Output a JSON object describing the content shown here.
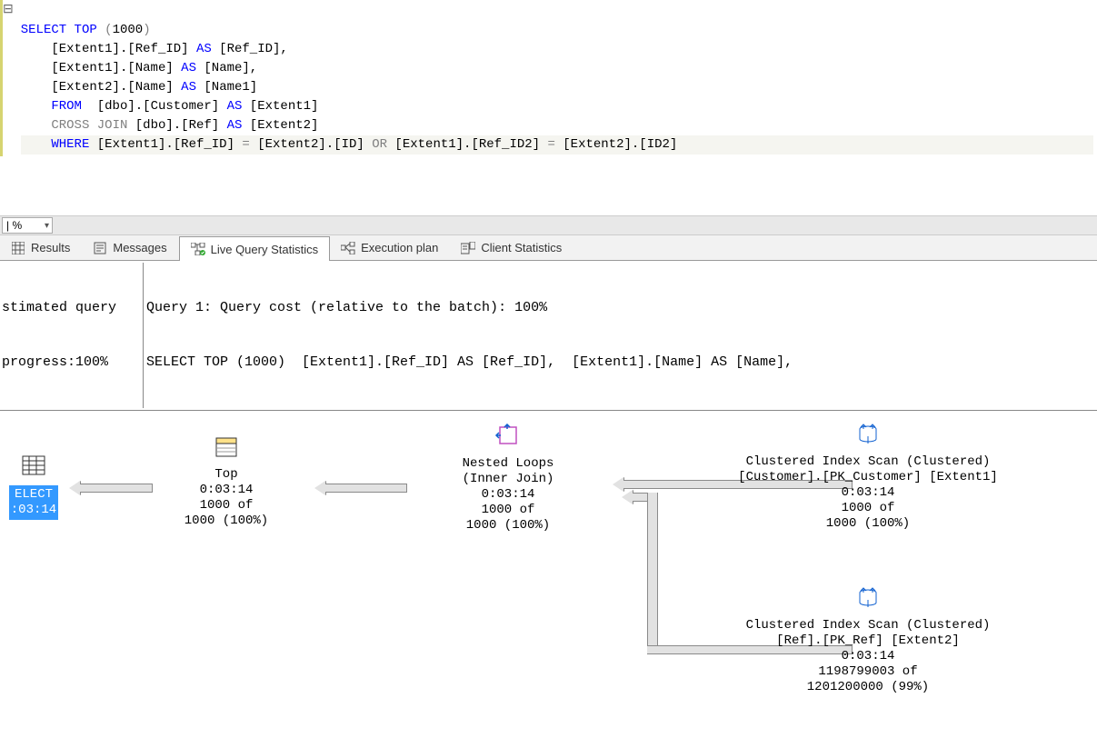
{
  "code": {
    "collapse_symbol": "⊟",
    "line1_a": "SELECT",
    "line1_b": " TOP ",
    "line1_c": "(",
    "line1_d": "1000",
    "line1_e": ")",
    "line2": "    [Extent1].[Ref_ID] ",
    "line2_as": "AS",
    "line2_b": " [Ref_ID],",
    "line3": "    [Extent1].[Name] ",
    "line3_as": "AS",
    "line3_b": " [Name],",
    "line4": "    [Extent2].[Name] ",
    "line4_as": "AS",
    "line4_b": " [Name1]",
    "line5_from": "    FROM",
    "line5_b": "  [dbo].[Customer] ",
    "line5_as": "AS",
    "line5_c": " [Extent1]",
    "line6_cross": "    CROSS",
    "line6_join": " JOIN",
    "line6_b": " [dbo].[Ref] ",
    "line6_as": "AS",
    "line6_c": " [Extent2]",
    "line7_where": "    WHERE",
    "line7_a": " [Extent1].[Ref_ID] ",
    "line7_eq1": "=",
    "line7_b": " [Extent2].[ID] ",
    "line7_or": "OR",
    "line7_c": " [Extent1].[Ref_ID2] ",
    "line7_eq2": "=",
    "line7_d": " [Extent2].[ID2]"
  },
  "zoom": {
    "value": "| % "
  },
  "tabs": {
    "results": "Results",
    "messages": "Messages",
    "live": "Live Query Statistics",
    "exec": "Execution plan",
    "client": "Client Statistics"
  },
  "header": {
    "left_line1": "stimated query",
    "left_line2": "progress:100%",
    "right_line1": "Query 1: Query cost (relative to the batch): 100%",
    "right_line2": "SELECT TOP (1000)  [Extent1].[Ref_ID] AS [Ref_ID],  [Extent1].[Name] AS [Name],"
  },
  "plan": {
    "select": {
      "label1": "ELECT",
      "label2": ":03:14"
    },
    "top": {
      "title": "Top",
      "time": "0:03:14",
      "rows": "1000 of",
      "pct": "1000 (100%)"
    },
    "nested": {
      "title": "Nested Loops",
      "sub": "(Inner Join)",
      "time": "0:03:14",
      "rows": "1000 of",
      "pct": "1000 (100%)"
    },
    "scan1": {
      "title": "Clustered Index Scan (Clustered)",
      "sub": "[Customer].[PK_Customer] [Extent1]",
      "time": "0:03:14",
      "rows": "1000 of",
      "pct": "1000 (100%)"
    },
    "scan2": {
      "title": "Clustered Index Scan (Clustered)",
      "sub": "[Ref].[PK_Ref] [Extent2]",
      "time": "0:03:14",
      "rows": "1198799003 of",
      "pct": "1201200000 (99%)"
    }
  }
}
